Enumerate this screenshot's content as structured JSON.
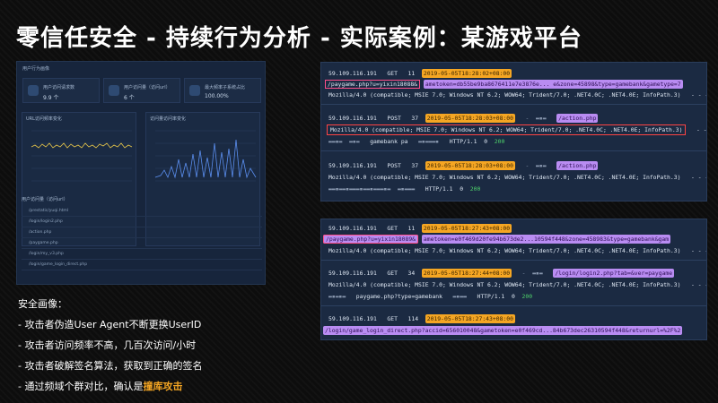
{
  "slide": {
    "title": "零信任安全 - 持续行为分析 - 实际案例：某游戏平台"
  },
  "dashboard": {
    "title": "用户行为画像",
    "stats": [
      {
        "label": "用户访问请求数",
        "value": "9.9 个"
      },
      {
        "label": "用户访问量（访问url）",
        "value": "6 个"
      },
      {
        "label": "最大频率子系统占比",
        "value": "100.00%"
      }
    ],
    "charts": [
      {
        "title": "URL访问频率变化"
      },
      {
        "title": "访问量访问率变化"
      }
    ],
    "list_title": "用户访问量（访问url）",
    "list_items": [
      "/prestatic/yuqi.html",
      "/login/login2.php",
      "/action.php",
      "/paygame.php",
      "/login/my_v3.php",
      "/login/game_login_direct.php"
    ]
  },
  "notes": {
    "heading": "安全画像：",
    "bullets": [
      "- 攻击者伪造User Agent不断更换UserID",
      "- 攻击者访问频率不高，几百次访问/小时",
      "- 攻击者破解签名算法，获取到正确的签名"
    ],
    "last_prefix": "- 通过频域个群对比，确认是",
    "last_highlight": "撞库攻击"
  },
  "log_top": {
    "entries": [
      {
        "ip": "59.109.116.191",
        "method": "GET",
        "num": "11",
        "timestamp": "2019-05-05T18:28:02+08:00",
        "url_hl": "/paygame.php?u=yixin18088&",
        "url_rest": "ametoken=db55be9ba8676411e7e3876e...  e&zone=45898&type=gamebank&gametype=7",
        "ua": "Mozilla/4.0 (compatible; MSIE 7.0; Windows NT 6.2; WOW64; Trident/7.0; .NET4.0C; .NET4.0E; InfoPath.3)",
        "tail": "-  -  -  new-nh-pay-m"
      },
      {
        "ip": "59.109.116.191",
        "method": "POST",
        "num": "37",
        "timestamp": "2019-05-05T18:28:03+08:00",
        "page": "/action.php",
        "ua": "Mozilla/4.0 (compatible; MSIE 7.0; Windows NT 6.2; WOW64; Trident/7.0; .NET4.0C; .NET4.0E; InfoPath.3)",
        "tail": "-  -  -  new-nh-pay-m",
        "line3": "gamebank  pa",
        "http": "HTTP/1.1",
        "code0": "0",
        "code": "200"
      },
      {
        "ip": "59.109.116.191",
        "method": "POST",
        "num": "37",
        "timestamp": "2019-05-05T18:28:03+08:00",
        "page": "/action.php",
        "ua": "Mozilla/4.0 (compatible; MSIE 7.0; Windows NT 6.2; WOW64; Trident/7.0; .NET4.0C; .NET4.0E; InfoPath.3)",
        "tail": "-  -  -  new-nh-pay-m",
        "http": "HTTP/1.1",
        "code0": "0",
        "code": "200"
      }
    ]
  },
  "log_bottom": {
    "entries": [
      {
        "ip": "59.109.116.191",
        "method": "GET",
        "num": "11",
        "timestamp": "2019-05-05T18:27:43+08:00",
        "url_hl": "/paygame.php?u=yixin18089&",
        "url_rest": "ametoken=e0f469d20fe94b673de2...10594f448&zone=458983&type=gamebank&gam",
        "ua": "Mozilla/4.0 (compatible; MSIE 7.0; Windows NT 6.2; WOW64; Trident/7.0; .NET4.0C; .NET4.0E; InfoPath.3)",
        "tail": "-  -  -  nj"
      },
      {
        "ip": "59.109.116.191",
        "method": "GET",
        "num": "34",
        "timestamp": "2019-05-05T18:27:44+08:00",
        "page": "/login/login2.php?tab=&ver=paygame",
        "ua": "Mozilla/4.0 (compatible; MSIE 7.0; Windows NT 6.2; WOW64; Trident/7.0; .NET4.0C; .NET4.0E; InfoPath.3)",
        "tail": "-  -  -  nj",
        "line3": "paygame.php?type=gamebank",
        "http": "HTTP/1.1",
        "code0": "0",
        "code": "200"
      },
      {
        "ip": "59.109.116.191",
        "method": "GET",
        "num": "114",
        "timestamp": "2019-05-05T18:27:43+08:00",
        "url_hl": "/login/game_login_direct.php?accid=656010048&gametoken=e0f469cd...84b673dec26310594f448&returnurl=%2F%2"
      }
    ]
  }
}
